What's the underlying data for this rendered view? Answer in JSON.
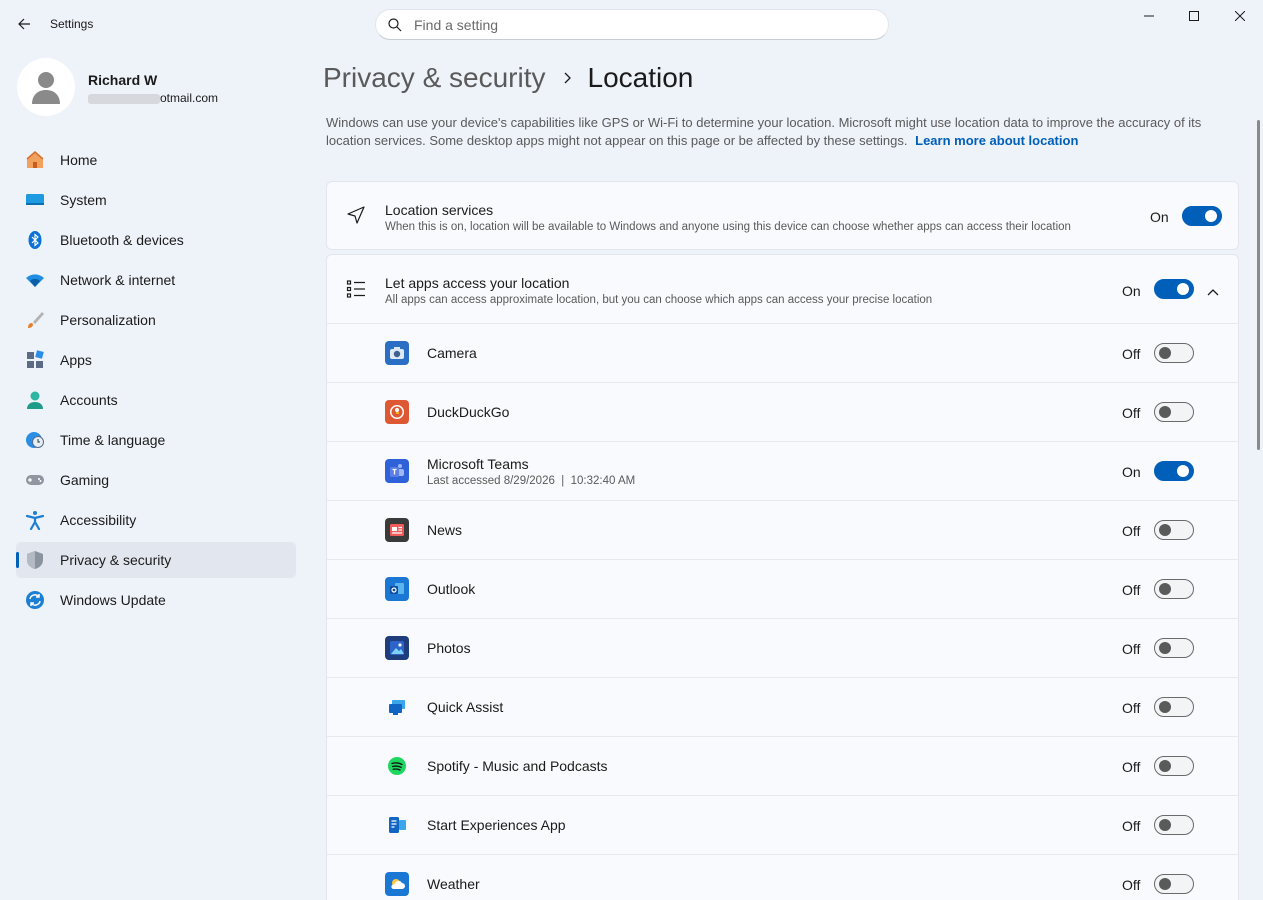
{
  "window": {
    "title": "Settings",
    "search_placeholder": "Find a setting"
  },
  "profile": {
    "name": "Richard W",
    "email_visible": "otmail.com"
  },
  "nav": [
    {
      "label": "Home",
      "icon": "home-icon"
    },
    {
      "label": "System",
      "icon": "system-icon"
    },
    {
      "label": "Bluetooth & devices",
      "icon": "bluetooth-icon"
    },
    {
      "label": "Network & internet",
      "icon": "wifi-icon"
    },
    {
      "label": "Personalization",
      "icon": "brush-icon"
    },
    {
      "label": "Apps",
      "icon": "apps-icon"
    },
    {
      "label": "Accounts",
      "icon": "accounts-icon"
    },
    {
      "label": "Time & language",
      "icon": "clock-globe-icon"
    },
    {
      "label": "Gaming",
      "icon": "gamepad-icon"
    },
    {
      "label": "Accessibility",
      "icon": "accessibility-icon"
    },
    {
      "label": "Privacy & security",
      "icon": "shield-icon",
      "active": true
    },
    {
      "label": "Windows Update",
      "icon": "update-icon"
    }
  ],
  "breadcrumb": {
    "parent": "Privacy & security",
    "current": "Location"
  },
  "description": {
    "text": "Windows can use your device's capabilities like GPS or Wi-Fi to determine your location. Microsoft might use location data to improve the accuracy of its location services. Some desktop apps might not appear on this page or be affected by these settings.",
    "link": "Learn more about location"
  },
  "location_services": {
    "title": "Location services",
    "subtitle": "When this is on, location will be available to Windows and anyone using this device can choose whether apps can access their location",
    "state": "On"
  },
  "apps_access": {
    "title": "Let apps access your location",
    "subtitle": "All apps can access approximate location, but you can choose which apps can access your precise location",
    "state": "On"
  },
  "apps": [
    {
      "name": "Camera",
      "state": "Off",
      "icon": "camera-app-icon"
    },
    {
      "name": "DuckDuckGo",
      "state": "Off",
      "icon": "duckduckgo-app-icon"
    },
    {
      "name": "Microsoft Teams",
      "state": "On",
      "icon": "teams-app-icon",
      "detail": "Last accessed 8/29/2026  |  10:32:40 AM"
    },
    {
      "name": "News",
      "state": "Off",
      "icon": "news-app-icon"
    },
    {
      "name": "Outlook",
      "state": "Off",
      "icon": "outlook-app-icon"
    },
    {
      "name": "Photos",
      "state": "Off",
      "icon": "photos-app-icon"
    },
    {
      "name": "Quick Assist",
      "state": "Off",
      "icon": "quick-assist-app-icon"
    },
    {
      "name": "Spotify - Music and Podcasts",
      "state": "Off",
      "icon": "spotify-app-icon"
    },
    {
      "name": "Start Experiences App",
      "state": "Off",
      "icon": "start-experiences-app-icon"
    },
    {
      "name": "Weather",
      "state": "Off",
      "icon": "weather-app-icon"
    }
  ],
  "colors": {
    "accent": "#005fb8",
    "background": "#eef2f9",
    "card": "#f9fafd"
  }
}
